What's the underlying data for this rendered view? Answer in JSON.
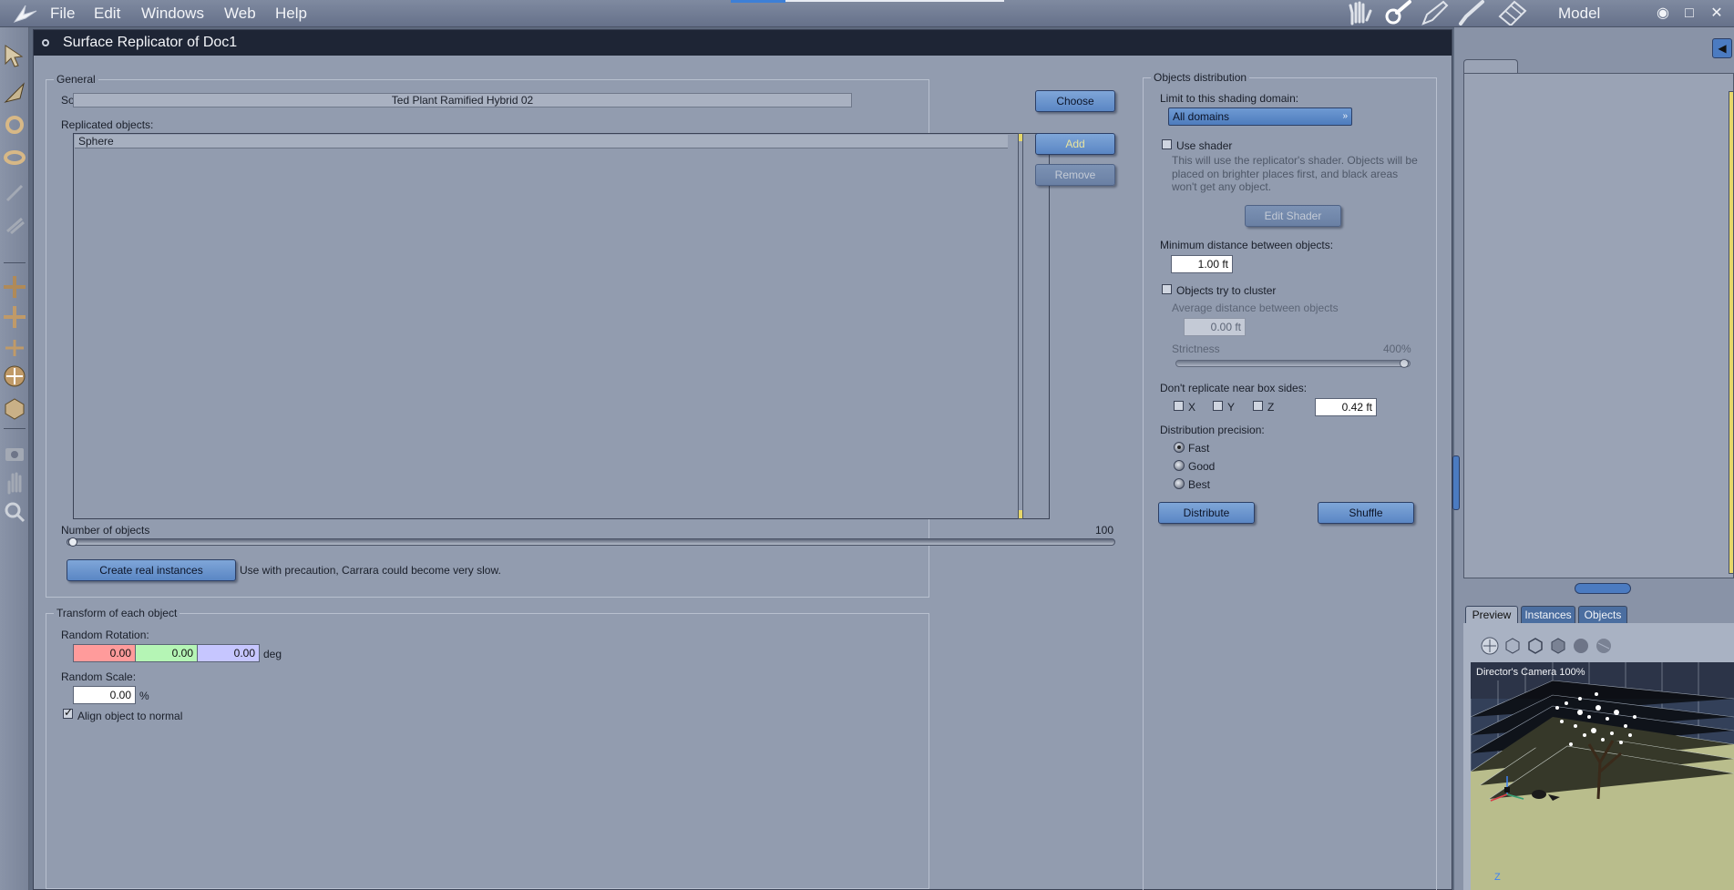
{
  "menubar": {
    "items": [
      "File",
      "Edit",
      "Windows",
      "Web",
      "Help"
    ],
    "room": "Model"
  },
  "dialog": {
    "title": "Surface Replicator of Doc1",
    "general": {
      "group_label": "General",
      "source_label": "Source object:",
      "source_value": "Ted Plant Ramified Hybrid 02",
      "choose_button": "Choose",
      "replicated_label": "Replicated objects:",
      "replicated_items": [
        "Sphere"
      ],
      "add_button": "Add",
      "remove_button": "Remove",
      "number_label": "Number of objects",
      "number_value": "100",
      "number_fraction": 0.0,
      "create_instances_button": "Create real instances",
      "create_instances_note": "Use with precaution, Carrara could become very slow."
    },
    "transform": {
      "group_label": "Transform of each object",
      "rotation_label": "Random Rotation:",
      "rotation_x": "0.00",
      "rotation_y": "0.00",
      "rotation_z": "0.00",
      "rotation_unit": "deg",
      "scale_label": "Random Scale:",
      "scale_value": "0.00",
      "scale_unit": "%",
      "align_label": "Align object to normal",
      "align_checked": true
    },
    "distribution": {
      "group_label": "Objects distribution",
      "domain_label": "Limit to this shading domain:",
      "domain_value": "All domains",
      "use_shader_label": "Use shader",
      "use_shader_hint": "This will use the replicator's shader. Objects will be placed on brighter places first, and black areas won't get any object.",
      "edit_shader_button": "Edit Shader",
      "min_distance_label": "Minimum distance between objects:",
      "min_distance_value": "1.00 ft",
      "cluster_label": "Objects try to cluster",
      "avg_distance_label": "Average distance between objects",
      "avg_distance_value": "0.00 ft",
      "strictness_label": "Strictness",
      "strictness_value": "400%",
      "strictness_fraction": 1.0,
      "box_sides_label": "Don't replicate near box sides:",
      "x_label": "X",
      "y_label": "Y",
      "z_label": "Z",
      "box_distance_value": "0.42 ft",
      "precision_label": "Distribution precision:",
      "precision_options": [
        "Fast",
        "Good",
        "Best"
      ],
      "precision_selected": "Fast",
      "distribute_button": "Distribute",
      "shuffle_button": "Shuffle"
    }
  },
  "right_panel": {
    "tabs": [
      "Preview",
      "Instances",
      "Objects"
    ],
    "active_tab": "Preview",
    "camera_label": "Director's Camera 100%",
    "axis_label": "Z"
  },
  "colors": {
    "dialog_bg": "#929caf",
    "title_bar": "#1e2535",
    "button_blue": "#6b94cc",
    "rotation_x": "#ff9b9b",
    "rotation_y": "#b5f5b5",
    "rotation_z": "#c6c6ff"
  }
}
